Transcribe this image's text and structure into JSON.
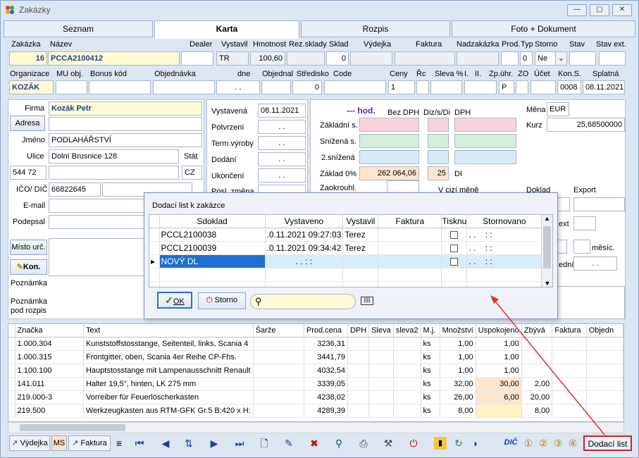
{
  "window": {
    "title": "Zakázky",
    "min": "—",
    "max": "▢",
    "close": "✕"
  },
  "tabs": [
    {
      "label": "Seznam"
    },
    {
      "label": "Karta"
    },
    {
      "label": "Rozpis"
    },
    {
      "label": "Foto + Dokument"
    }
  ],
  "header1": {
    "labels": {
      "zakazka": "Zakázka",
      "nazev": "Název",
      "dealer": "Dealer",
      "vystavil": "Vystavil",
      "hmotnost": "Hmotnost",
      "rez_sklady": "Rez.sklady",
      "sklad": "Sklad",
      "vydejka": "Výdejka",
      "faktura": "Faktura",
      "nadzakazka": "Nadzakázka",
      "prod": "Prod.",
      "typ": "Typ",
      "storno": "Storno",
      "stav": "Stav",
      "stav_ext": "Stav ext."
    },
    "values": {
      "zakazka": "16",
      "nazev": "PCCA2100412",
      "dealer": "",
      "vystavil": "TR",
      "hmotnost": "100,60",
      "rez_sklady": "",
      "sklad": "0",
      "vydejka": "",
      "faktura": "",
      "nadzakazka": "",
      "prod": "",
      "typ": "0",
      "storno": "Ne",
      "stav": "",
      "stav_ext": ""
    }
  },
  "header2": {
    "labels": {
      "organizace": "Organizace",
      "mu_obj": "MU obj.",
      "bonus_kod": "Bonus kód",
      "objednavka": "Objednávka",
      "dne": "dne",
      "objednal": "Objednal",
      "stredisko": "Středisko",
      "code": "Code",
      "ceny": "Ceny",
      "rc": "Řc",
      "sleva": "Sleva %",
      "i": "I.",
      "ii": "II.",
      "zp_uhr": "Zp.úhr.",
      "zo": "ZO",
      "ucet": "Účet",
      "kon_s": "Kon.S.",
      "splatna": "Splatná"
    },
    "values": {
      "organizace": "KOZÁK",
      "dne": ". .",
      "stredisko": "0",
      "ceny": "1",
      "zp_uhr": "P",
      "kon_s": "0008",
      "splatna": "08.11.2021"
    }
  },
  "customer": {
    "firma_label": "Firma",
    "firma": "Kozák Petr",
    "adresa_button": "Adresa",
    "jmeno_label": "Jméno",
    "jmeno": "PODLAHÁŘSTVÍ",
    "ulice_label": "Ulice",
    "ulice": "Dolní Brusnice 128",
    "stat_label": "Stát",
    "psc": "544 72",
    "stat": "CZ",
    "ico_label": "IČO/ DIČ",
    "ico": "66822645",
    "email_label": "E-mail",
    "podepsal_label": "Podepsal",
    "misto_urc_button": "Místo urč.",
    "kon_button": "Kon.",
    "poznamka_label": "Poznámka",
    "poznamka_rozpis_label1": "Poznámka",
    "poznamka_rozpis_label2": "pod rozpis"
  },
  "dates": {
    "vystavena_label": "Vystavená",
    "vystavena": "08.11.2021",
    "potvrzeni_label": "Potvrzení",
    "term_vyroby_label": "Term.výroby",
    "dodani_label": "Dodání",
    "ukonceni_label": "Ukončení",
    "posl_zmena_label": "Posl. změna",
    "empty_date": ". ."
  },
  "totals": {
    "hod": "--- hod.",
    "bez_dph": "Bez DPH",
    "diz": "Diz/s/Di",
    "dph": "DPH",
    "zakladni_label": "Základní s.",
    "snizena_label": "Snížená s.",
    "snizena2_label": "2.snížená",
    "zaklad0_label": "Základ 0%",
    "zaklad0": "262 064,06",
    "zaklad0_diz": "25",
    "di": "DI",
    "zaokrouhl_label": "Zaokrouhl.",
    "v_cizi_mene": "V cizí měně",
    "doklad": "Doklad",
    "export": "Export",
    "mena_label": "Měna",
    "mena": "EUR",
    "kurz_label": "Kurz",
    "kurz": "25,68500000",
    "ext": "ext",
    "mesic": "měsíc.",
    "edni": "ední",
    "edni_val": ". ."
  },
  "items": {
    "columns": [
      "Značka",
      "Text",
      "Šarže",
      "Prod.cena",
      "DPH",
      "Sleva",
      "sleva2",
      "M.j.",
      "Množství",
      "Uspokojeno",
      "Zbývá",
      "Faktura",
      "Objedn"
    ],
    "rows": [
      {
        "znacka": "1.000.304",
        "text": "Kunststoffstosstange, Seitenteil, links, Scania 4",
        "sarze": "",
        "cena": "3236,31",
        "mj": "ks",
        "mnozstvi": "1,00",
        "uspokojeno": "1,00",
        "zbyva": ""
      },
      {
        "znacka": "1.000.315",
        "text": "Frontgitter, oben, Scania 4er Reihe CP-Fhs.",
        "sarze": "",
        "cena": "3441,79",
        "mj": "ks",
        "mnozstvi": "1,00",
        "uspokojeno": "1,00",
        "zbyva": ""
      },
      {
        "znacka": "1.100.100",
        "text": "Hauptstosstange mit Lampenausschnitt Renault",
        "sarze": "",
        "cena": "4032,54",
        "mj": "ks",
        "mnozstvi": "1,00",
        "uspokojeno": "1,00",
        "zbyva": ""
      },
      {
        "znacka": "141.011",
        "text": "Halter 19,5\", hinten, LK 275 mm",
        "sarze": "",
        "cena": "3339,05",
        "mj": "ks",
        "mnozstvi": "32,00",
        "uspokojeno": "30,00",
        "zbyva": "2,00"
      },
      {
        "znacka": "219.000-3",
        "text": "Vorreiber für Feuerlöscherkasten",
        "sarze": "",
        "cena": "4238,02",
        "mj": "ks",
        "mnozstvi": "26,00",
        "uspokojeno": "6,00",
        "zbyva": "20,00"
      },
      {
        "znacka": "219.500",
        "text": "Werkzeugkasten aus RTM-GFK Gr.5 B:420 x H:",
        "sarze": "",
        "cena": "4289,39",
        "mj": "ks",
        "mnozstvi": "8,00",
        "uspokojeno": "",
        "zbyva": "8,00"
      }
    ]
  },
  "dialog": {
    "title": "Dodací list k zakázce",
    "columns": [
      "Sdoklad",
      "Vystaveno",
      "Vystavil",
      "Faktura",
      "Tisknu",
      "Stornovano"
    ],
    "rows": [
      {
        "sdoklad": "PCCL2100038",
        "vystaveno": ".0.11.2021 09:27:03",
        "vystavil": "Terez",
        "faktura": "",
        "stornovano": ". .    : :"
      },
      {
        "sdoklad": "PCCL2100039",
        "vystaveno": ".0.11.2021 09:34:42",
        "vystavil": "Terez",
        "faktura": "",
        "stornovano": ". .    : :"
      },
      {
        "sdoklad": "NOVÝ DL",
        "vystaveno": ". .    : :",
        "vystavil": "",
        "faktura": "",
        "stornovano": ". .    : :"
      }
    ],
    "ok": "OK",
    "storno": "Storno",
    "search_placeholder": ""
  },
  "toolbar": {
    "vydejka": "Výdejka",
    "ms": "MS",
    "faktura": "Faktura",
    "dic": "DIČ",
    "dodaci_list": "Dodací list"
  }
}
